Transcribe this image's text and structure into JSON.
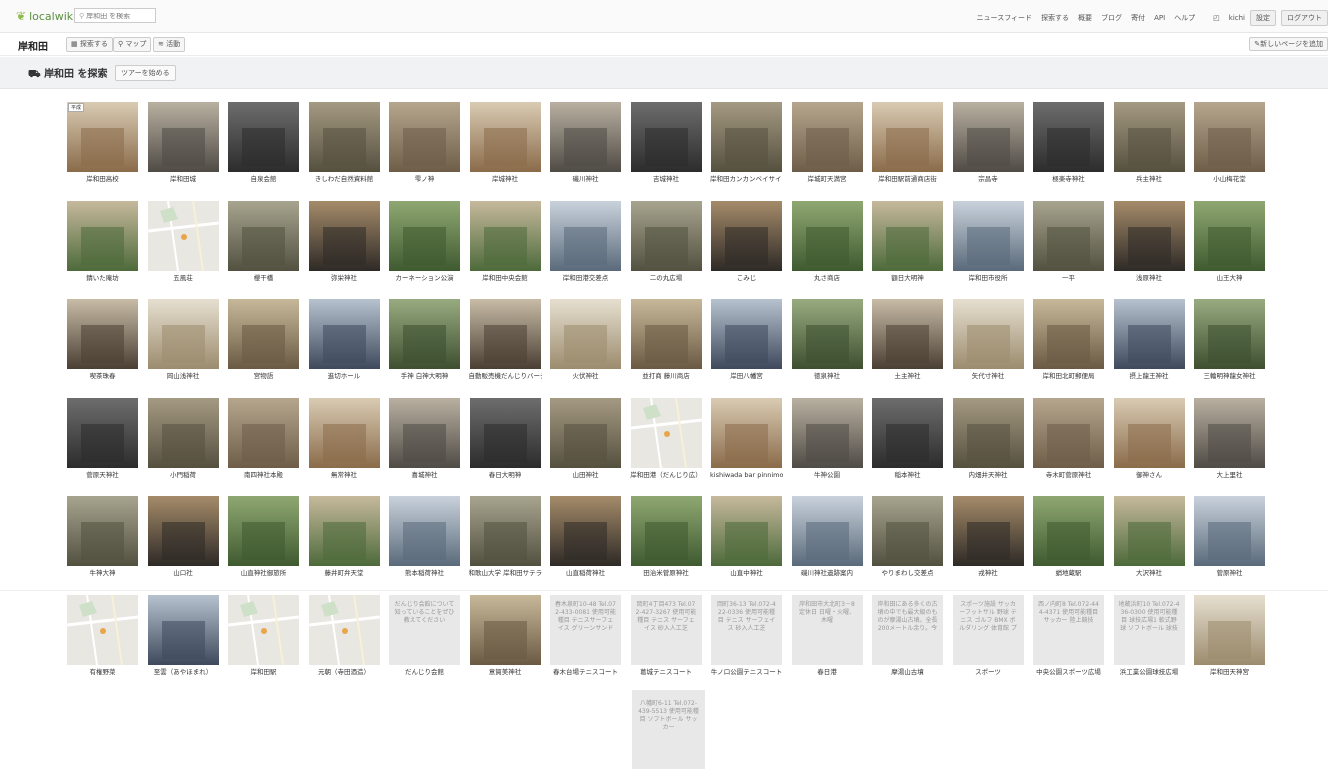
{
  "topbar": {
    "logo_text": "localwiki",
    "search_placeholder": "岸和田 を検索",
    "nav": [
      "ニュースフィード",
      "探索する",
      "概要",
      "ブログ",
      "寄付",
      "API",
      "ヘルプ"
    ],
    "user": "kichi",
    "settings": "設定",
    "logout": "ログアウト"
  },
  "subbar": {
    "region": "岸和田",
    "explore": "探索する",
    "map": "マップ",
    "activity": "活動",
    "add_page": "新しいページを追加"
  },
  "explore": {
    "title": "岸和田 を探索",
    "tour": "ツアーを始める"
  },
  "tiles": [
    [
      "岸和田高校",
      "岸和田城",
      "自泉会館",
      "きしわだ自然資料館",
      "雫ノ神",
      "岸城神社",
      "磯川神社",
      "吉城神社",
      "岸和田カンカンベイサイドモール",
      "岸城町天満宮",
      "岸和田駅前通商店街",
      "宗昌寺",
      "極楽寺神社",
      "兵主神社",
      "小山梅花堂"
    ],
    [
      "錆いた庵坊",
      "五風荘",
      "櫻干橋",
      "弥栄神社",
      "カーネーション公演",
      "岸和田中央会館",
      "岸和田港交差点",
      "二の丸広場",
      "こみじ",
      "丸さ商店",
      "額日大明神",
      "岸和田市役所",
      "一平",
      "浅原神社",
      "山王大神"
    ],
    [
      "喫茶珠春",
      "岡山浅神社",
      "宮物語",
      "進切ホール",
      "手神 白神大明神",
      "自動販売機だんじりバージョン",
      "火伏神社",
      "並打商 藤川商店",
      "岸田八幡宮",
      "徳泉神社",
      "土主神社",
      "矢代寸神社",
      "岸和田北町郵便局",
      "摂上龍王神社",
      "三輪明神龍女神社"
    ],
    [
      "菅原天神社",
      "小門稲荷",
      "南四神社本殿",
      "無常神社",
      "喜城神社",
      "春日大明神",
      "山田神社",
      "岸和田港（だんじり広）",
      "kishiwada bar pinnimol",
      "牛神公園",
      "稲本神社",
      "内畑井天神社",
      "寺木町菅原神社",
      "御神さん",
      "大上里社"
    ],
    [
      "牛神大神",
      "山口社",
      "山直神社御旅所",
      "藤井町弁天堂",
      "熊本稲荷神社",
      "和歌山大学 岸和田サテライト",
      "山直稲荷神社",
      "田治米菅原神社",
      "山直中神社",
      "磯川神社遺跡案内",
      "やりまわし交差点",
      "戎神社",
      "蛸地蔵駅",
      "大沢神社",
      "菅原神社"
    ],
    [
      "有権野菜",
      "至雲（あやほまれ）",
      "岸和田駅",
      "元朝（寺田酒造）",
      "だんじり会館",
      "意賀美神社",
      "春木台場テニスコート",
      "葛城テニスコート",
      "牛ノ口公園テニスコート",
      "春日港",
      "摩湯山古墳",
      "スポーツ",
      "中央公園スポーツ広場",
      "浜工業公園球技広場",
      "岸和田天神宮"
    ]
  ],
  "tile_texts": [
    {
      "index": 4,
      "text": "だんじり会館について知っていることをぜひ教えてください"
    },
    {
      "index": 6,
      "text": "春木泉町10-48 Tel.072-433-0081 使用可能種目 テニスサーフェイス グリーンサンド"
    },
    {
      "index": 7,
      "text": "岡町4丁目473 Tel.072-427-3267 使用可能種目 テニス サーフェイス 砂入人工芝"
    },
    {
      "index": 8,
      "text": "岡町36-13 Tel.072-422-0336 使用可能種目 テニス サーフェイス 砂入人工芝"
    },
    {
      "index": 9,
      "text": "岸和田市大北町3－8 定休日 日曜・火曜、木曜"
    },
    {
      "index": 10,
      "text": "岸和田にある多くの古墳の中でも最大級のものが摩湯山古墳。全長200メートル余り。今"
    },
    {
      "index": 11,
      "text": "スポーツ施設 サッカーフットサル 野球 テニス ゴルフ BMX ボルダリング 体育館 プ"
    },
    {
      "index": 12,
      "text": "西ノ内町8 Tel.072-444-4371 使用可能種目 サッカー 陸上競技"
    },
    {
      "index": 13,
      "text": "地蔵浜町10 Tel.072-436-0300 使用可能種目 球技広場1 軟式野球 ソフトボール 球技"
    }
  ],
  "lone_text": "八幡町6-11 Tel.072-439-5513 使用可能種目 ソフトボール サッカー",
  "tile_badge": "平成"
}
